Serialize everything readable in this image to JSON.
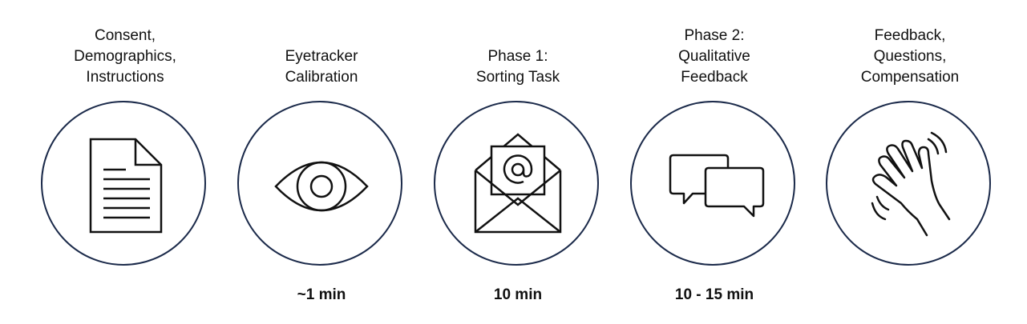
{
  "stages": [
    {
      "title": "Consent,\nDemographics,\nInstructions",
      "duration": "",
      "icon": "document-icon"
    },
    {
      "title": "Eyetracker\nCalibration",
      "duration": "~1 min",
      "icon": "eye-icon"
    },
    {
      "title": "Phase 1:\nSorting Task",
      "duration": "10 min",
      "icon": "email-envelope-icon"
    },
    {
      "title": "Phase 2:\nQualitative\nFeedback",
      "duration": "10 - 15 min",
      "icon": "chat-bubbles-icon"
    },
    {
      "title": "Feedback,\nQuestions,\nCompensation",
      "duration": "",
      "icon": "waving-hand-icon"
    }
  ],
  "colors": {
    "circle_stroke": "#1b2a4a",
    "icon_stroke": "#111111",
    "text": "#111111"
  }
}
